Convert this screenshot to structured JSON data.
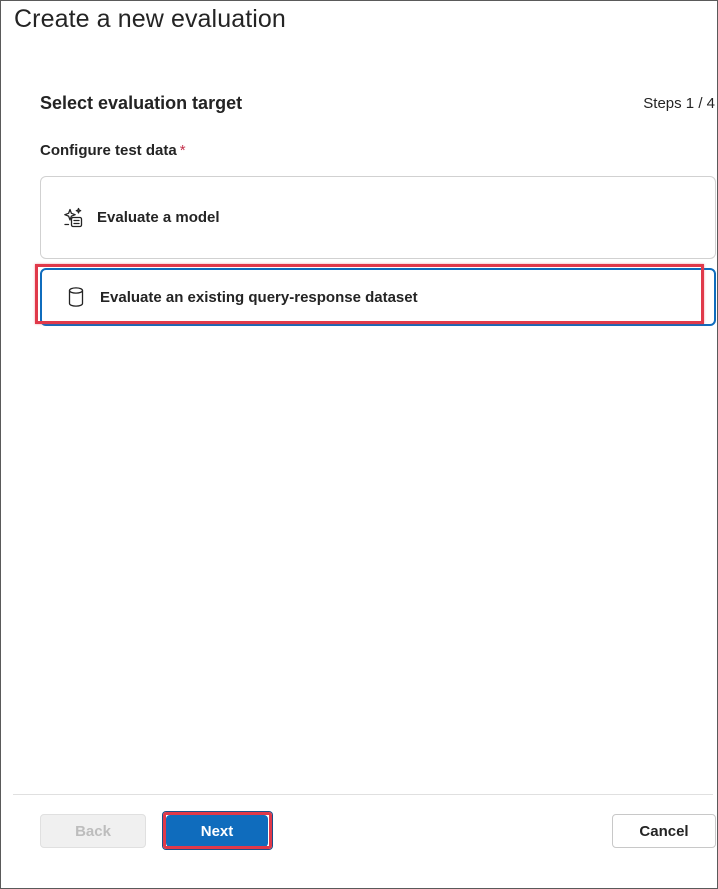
{
  "dialog": {
    "title": "Create a new evaluation"
  },
  "section": {
    "heading": "Select evaluation target",
    "steps": "Steps 1 / 4"
  },
  "field": {
    "label": "Configure test data",
    "required_marker": "*"
  },
  "options": [
    {
      "label": "Evaluate a model",
      "icon": "sparkle-list-icon",
      "selected": false
    },
    {
      "label": "Evaluate an existing query-response dataset",
      "icon": "database-icon",
      "selected": true
    }
  ],
  "footer": {
    "back_label": "Back",
    "next_label": "Next",
    "cancel_label": "Cancel"
  },
  "colors": {
    "accent": "#0f6cbd",
    "highlight": "#e0394a",
    "required": "#c4314b",
    "disabled_text": "#bdbdbd"
  }
}
